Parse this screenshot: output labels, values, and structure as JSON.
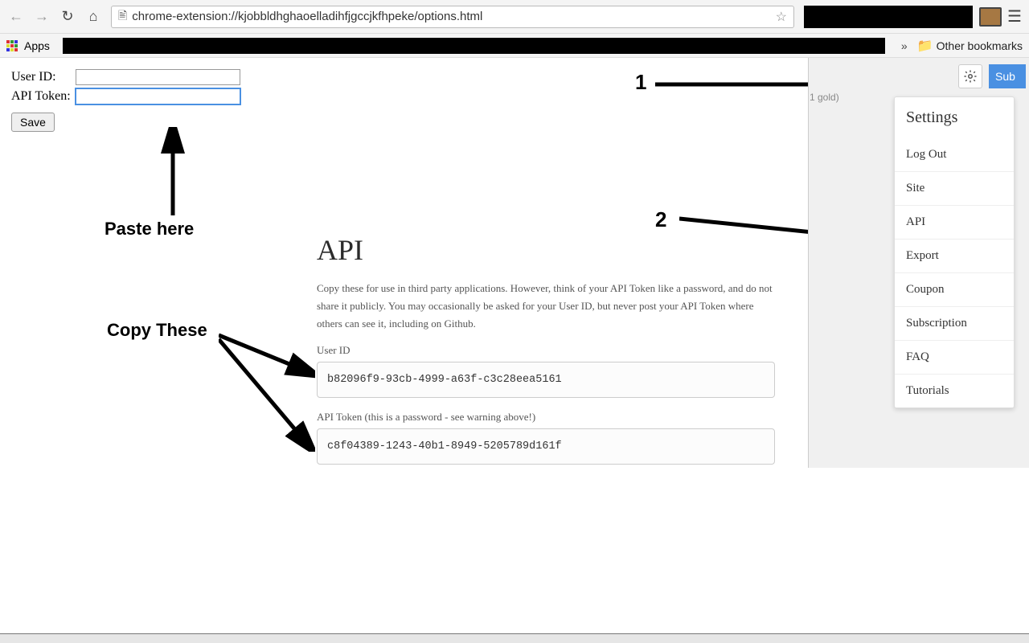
{
  "browser": {
    "url": "chrome-extension://kjobbldhghaoelladihfjgccjkfhpeke/options.html",
    "apps_label": "Apps",
    "other_bookmarks": "Other bookmarks"
  },
  "options": {
    "user_id_label": "User ID:",
    "api_token_label": "API Token:",
    "user_id_value": "",
    "api_token_value": "",
    "save_label": "Save"
  },
  "annotations": {
    "paste_here": "Paste here",
    "copy_these": "Copy These",
    "step1": "1",
    "step2": "2"
  },
  "api": {
    "heading": "API",
    "description": "Copy these for use in third party applications. However, think of your API Token like a password, and do not share it publicly. You may occasionally be asked for your User ID, but never post your API Token where others can see it, including on Github.",
    "user_id_label": "User ID",
    "user_id_value": "b82096f9-93cb-4999-a63f-c3c28eea5161",
    "api_token_label": "API Token (this is a password - see warning above!)",
    "api_token_value": "c8f04389-1243-40b1-8949-5205789d161f"
  },
  "dropdown": {
    "header": "Settings",
    "items": [
      "Log Out",
      "Site",
      "API",
      "Export",
      "Coupon",
      "Subscription",
      "FAQ",
      "Tutorials"
    ]
  },
  "topbar": {
    "gold_text": "1 gold)",
    "sub_label": "Sub"
  }
}
